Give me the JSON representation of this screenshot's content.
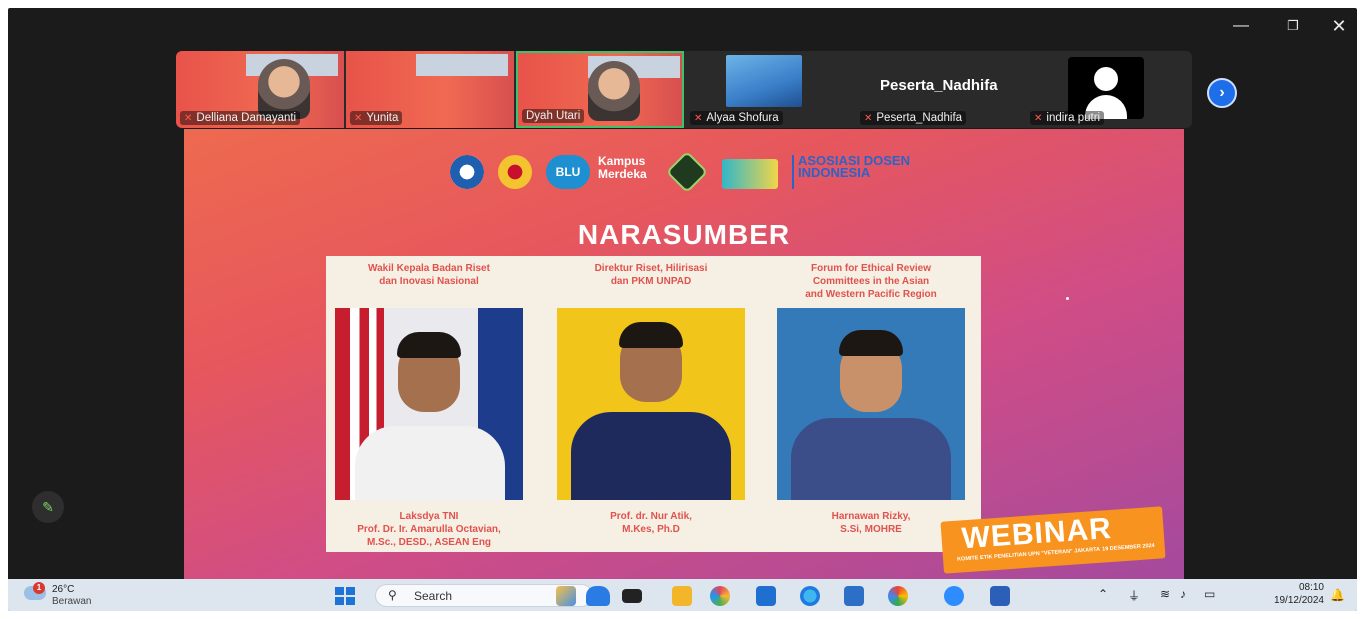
{
  "window": {
    "minimize": "—",
    "maximize": "❐",
    "close": "✕"
  },
  "participants": [
    {
      "name": "Delliana Damayanti",
      "muted": true
    },
    {
      "name": "Yunita",
      "muted": true
    },
    {
      "name": "Dyah Utari",
      "muted": false,
      "active_speaker": true
    },
    {
      "name": "Alyaa Shofura",
      "muted": true
    },
    {
      "name": "Peserta_Nadhifa",
      "muted": true,
      "display_text": "Peserta_Nadhifa"
    },
    {
      "name": "indira putri",
      "muted": true
    }
  ],
  "slide": {
    "logos": {
      "blu": "BLU",
      "kampus": "Kampus Merdeka",
      "asosiasi": "ASOSIASI DOSEN INDONESIA"
    },
    "title": "NARASUMBER",
    "speakers": [
      {
        "role": "Wakil Kepala Badan Riset\ndan Inovasi Nasional",
        "name": "Laksdya TNI\nProf. Dr. Ir. Amarulla Octavian,\nM.Sc., DESD., ASEAN Eng"
      },
      {
        "role": "Direktur Riset, Hilirisasi\ndan PKM UNPAD",
        "name": "Prof. dr. Nur Atik,\nM.Kes, Ph.D"
      },
      {
        "role": "Forum for Ethical Review\nCommittees in the Asian\nand Western Pacific Region",
        "name": "Harnawan Rizky,\nS.Si, MOHRE"
      }
    ],
    "webinar": {
      "label": "WEBINAR",
      "sub": "KOMITE ETIK PENELITIAN UPN \"VETERAN\" JAKARTA",
      "date": "19 DESEMBER 2024"
    }
  },
  "taskbar": {
    "weather": {
      "temp": "26°C",
      "condition": "Berawan",
      "badge": "1"
    },
    "search_placeholder": "Search",
    "clock": {
      "time": "08:10",
      "date": "19/12/2024"
    }
  },
  "colors": {
    "accent_green": "#3fc06a",
    "taskbar_bg": "#dde5ef",
    "speaker_text": "#e0524e",
    "webinar_orange": "#f7931e"
  }
}
